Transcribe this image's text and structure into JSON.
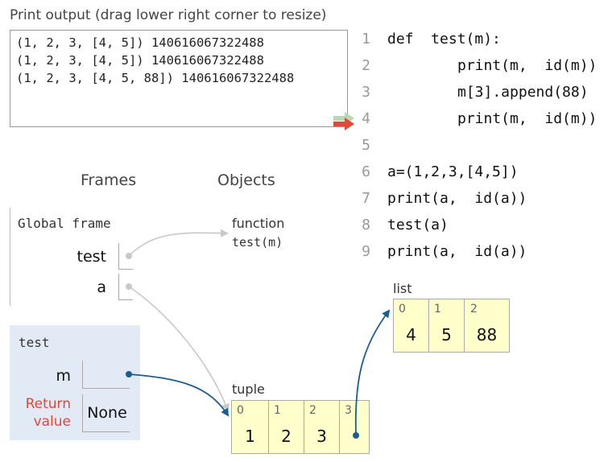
{
  "print_output": {
    "title": "Print output (drag lower right corner to resize)",
    "lines": [
      "(1, 2, 3, [4, 5]) 140616067322488",
      "(1, 2, 3, [4, 5]) 140616067322488",
      "(1, 2, 3, [4, 5, 88]) 140616067322488"
    ]
  },
  "code": {
    "lines": [
      {
        "num": "1",
        "text": "def  test(m):"
      },
      {
        "num": "2",
        "text": "print(m,  id(m))"
      },
      {
        "num": "3",
        "text": "m[3].append(88)"
      },
      {
        "num": "4",
        "text": "print(m,  id(m))"
      },
      {
        "num": "5",
        "text": ""
      },
      {
        "num": "6",
        "text": "a=(1,2,3,[4,5])"
      },
      {
        "num": "7",
        "text": "print(a,  id(a))"
      },
      {
        "num": "8",
        "text": "test(a)"
      },
      {
        "num": "9",
        "text": "print(a,  id(a))"
      }
    ],
    "prev_line_arrow_color": "#b5d9b5",
    "next_line_arrow_color": "#e0483a"
  },
  "headers": {
    "frames": "Frames",
    "objects": "Objects"
  },
  "global_frame": {
    "label": "Global frame",
    "vars": [
      {
        "name": "test"
      },
      {
        "name": "a"
      }
    ]
  },
  "test_frame": {
    "label": "test",
    "var_name": "m",
    "return_label_1": "Return",
    "return_label_2": "value",
    "return_value": "None"
  },
  "heap": {
    "function": {
      "type_label": "function",
      "signature": "test(m)"
    },
    "list": {
      "type_label": "list",
      "indices": [
        "0",
        "1",
        "2"
      ],
      "values": [
        "4",
        "5",
        "88"
      ]
    },
    "tuple": {
      "type_label": "tuple",
      "indices": [
        "0",
        "1",
        "2",
        "3"
      ],
      "values": [
        "1",
        "2",
        "3",
        ""
      ]
    }
  },
  "colors": {
    "pointer_active": "#1b5d8c",
    "pointer_inactive": "#c8c8c8",
    "cell_bg": "#ffffcc",
    "frame_bg": "#e2eaf5",
    "return_label": "#e0483a"
  }
}
